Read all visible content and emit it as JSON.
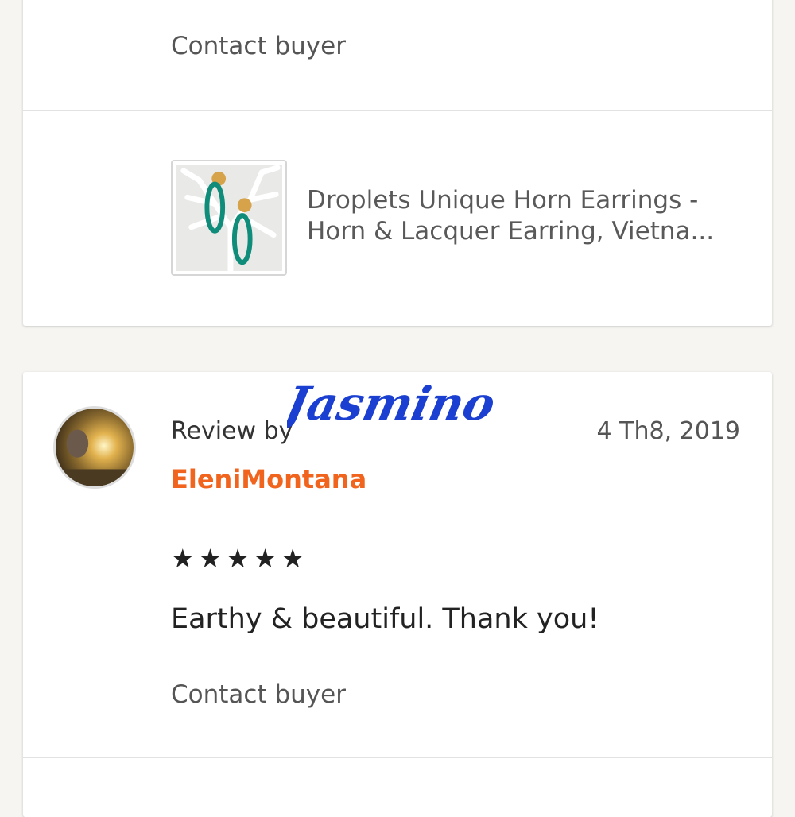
{
  "top_card": {
    "contact_label": "Contact buyer",
    "item": {
      "title": "Droplets Unique Horn Earrings - Horn & Lacquer Earring, Vietna..."
    }
  },
  "review_card": {
    "review_by_label": "Review by",
    "signature_text": "Jasmino",
    "date": "4 Th8, 2019",
    "reviewer_name": "EleniMontana",
    "rating": 5,
    "stars": [
      "★",
      "★",
      "★",
      "★",
      "★"
    ],
    "text": "Earthy & beautiful. Thank you!",
    "contact_label": "Contact buyer"
  },
  "colors": {
    "background": "#f6f5f2",
    "card": "#ffffff",
    "reviewer_name": "#f1641e",
    "signature": "#1a3fd1",
    "stars": "#222222"
  }
}
